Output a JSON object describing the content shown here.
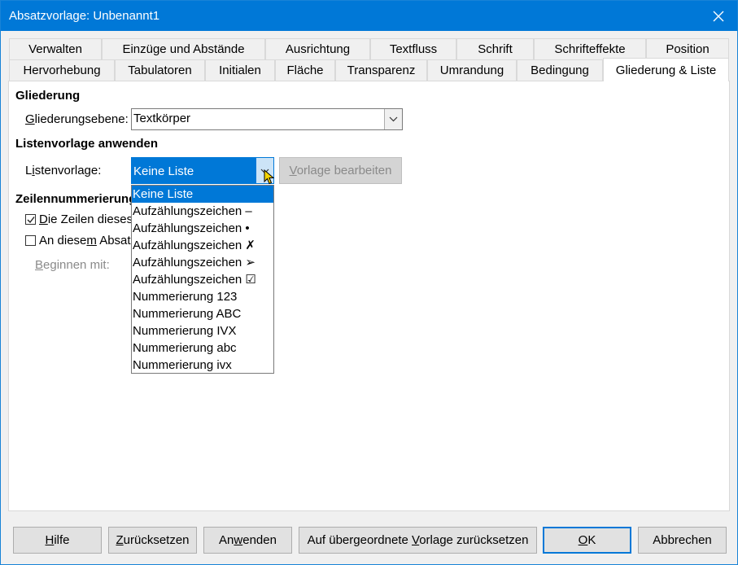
{
  "window": {
    "title": "Absatzvorlage: Unbenannt1"
  },
  "tabs_row1": [
    {
      "label": "Verwalten"
    },
    {
      "label": "Einzüge und Abstände"
    },
    {
      "label": "Ausrichtung"
    },
    {
      "label": "Textfluss"
    },
    {
      "label": "Schrift"
    },
    {
      "label": "Schrifteffekte"
    },
    {
      "label": "Position"
    }
  ],
  "tabs_row2": [
    {
      "label": "Hervorhebung"
    },
    {
      "label": "Tabulatoren"
    },
    {
      "label": "Initialen"
    },
    {
      "label": "Fläche"
    },
    {
      "label": "Transparenz"
    },
    {
      "label": "Umrandung"
    },
    {
      "label": "Bedingung"
    },
    {
      "label": "Gliederung & Liste",
      "active": true
    }
  ],
  "gliederung": {
    "heading": "Gliederung",
    "level_label_u": "G",
    "level_label_rest": "liederungsebene:",
    "level_value": "Textkörper"
  },
  "liste": {
    "heading": "Listenvorlage anwenden",
    "label_pre": "L",
    "label_u": "i",
    "label_rest": "stenvorlage:",
    "value": "Keine Liste",
    "edit_button_u": "V",
    "edit_button_rest": "orlage bearbeiten",
    "options": [
      "Keine Liste",
      "Aufzählungszeichen –",
      "Aufzählungszeichen •",
      "Aufzählungszeichen ✗",
      "Aufzählungszeichen ➢",
      "Aufzählungszeichen ☑",
      "Nummerierung 123",
      "Nummerierung ABC",
      "Nummerierung IVX",
      "Nummerierung abc",
      "Nummerierung ivx"
    ],
    "selected_index": 0
  },
  "zeilen": {
    "heading": "Zeilennummerierung",
    "check1_u": "D",
    "check1_rest": "ie Zeilen dieses",
    "check1_checked": true,
    "check2_pre": "An diese",
    "check2_u": "m",
    "check2_rest": " Absat",
    "check2_checked": false,
    "start_label_u": "B",
    "start_label_rest": "eginnen mit:"
  },
  "buttons": {
    "help_u": "H",
    "help_rest": "ilfe",
    "reset_pre": "",
    "reset_u": "Z",
    "reset_rest": "urücksetzen",
    "apply_pre": "An",
    "apply_u": "w",
    "apply_rest": "enden",
    "parent_pre": "Auf übergeordnete ",
    "parent_u": "V",
    "parent_rest": "orlage zurücksetzen",
    "ok_u": "O",
    "ok_rest": "K",
    "cancel": "Abbrechen"
  },
  "colors": {
    "accent": "#0078d7",
    "disabled_text": "#8a8a8a"
  }
}
